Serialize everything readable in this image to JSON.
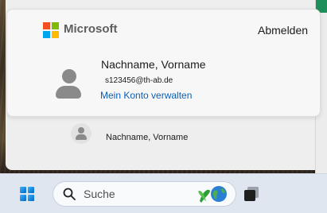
{
  "card": {
    "brand": "Microsoft",
    "signout_label": "Abmelden",
    "account_name": "Nachname, Vorname",
    "account_email": "s123456@th-ab.de",
    "manage_label": "Mein Konto verwalten"
  },
  "other_accounts": [
    {
      "name": "Nachname, Vorname"
    }
  ],
  "taskbar": {
    "search_label": "Suche"
  },
  "colors": {
    "link": "#0a5fb5",
    "ms_red": "#f25022",
    "ms_green": "#7fba00",
    "ms_blue": "#00a4ef",
    "ms_yellow": "#ffb900",
    "taskbar_bg": "#dfe6ef"
  },
  "icons": {
    "brand": "microsoft-logo",
    "avatar": "person-avatar-icon",
    "start": "windows-logo-icon",
    "search": "search-icon",
    "search_highlight": "earth-day-ribbon-icon",
    "taskview": "task-view-icon"
  }
}
